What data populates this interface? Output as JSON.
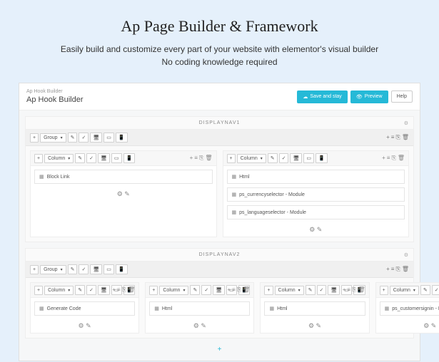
{
  "hero": {
    "title": "Ap Page Builder & Framework",
    "line1": "Easily build and customize every part of your website with elementor's visual builder",
    "line2": "No coding knowledge required"
  },
  "app": {
    "breadcrumb": "Ap Hook Builder",
    "title": "Ap Hook Builder",
    "save_btn": "Save and stay",
    "preview_btn": "Preview",
    "help_btn": "Help"
  },
  "labels": {
    "group": "Group",
    "column": "Column"
  },
  "icons": {
    "plus": "+",
    "gear": "⚙",
    "pencil": "✎",
    "check": "✓",
    "desktop": "🖥",
    "tablet": "▭",
    "mobile": "📱",
    "menu": "≡",
    "duplicate": "⎘",
    "trash": "🗑"
  },
  "chart_data": [
    {
      "type": "table",
      "title": "DISPLAYNAV1",
      "columns": [
        {
          "widgets": [
            {
              "icon": "list",
              "label": "Block Link"
            }
          ]
        },
        {
          "widgets": [
            {
              "icon": "html",
              "label": "Html"
            },
            {
              "icon": "module",
              "label": "ps_currencyselector - Module"
            },
            {
              "icon": "module",
              "label": "ps_languageselector - Module"
            }
          ]
        }
      ]
    },
    {
      "type": "table",
      "title": "DISPLAYNAV2",
      "columns": [
        {
          "widgets": [
            {
              "icon": "module",
              "label": "Generate Code"
            }
          ]
        },
        {
          "widgets": [
            {
              "icon": "html",
              "label": "Html"
            }
          ]
        },
        {
          "widgets": [
            {
              "icon": "html",
              "label": "Html"
            }
          ]
        },
        {
          "widgets": [
            {
              "icon": "module",
              "label": "ps_customersignin - Module"
            }
          ]
        }
      ]
    }
  ]
}
